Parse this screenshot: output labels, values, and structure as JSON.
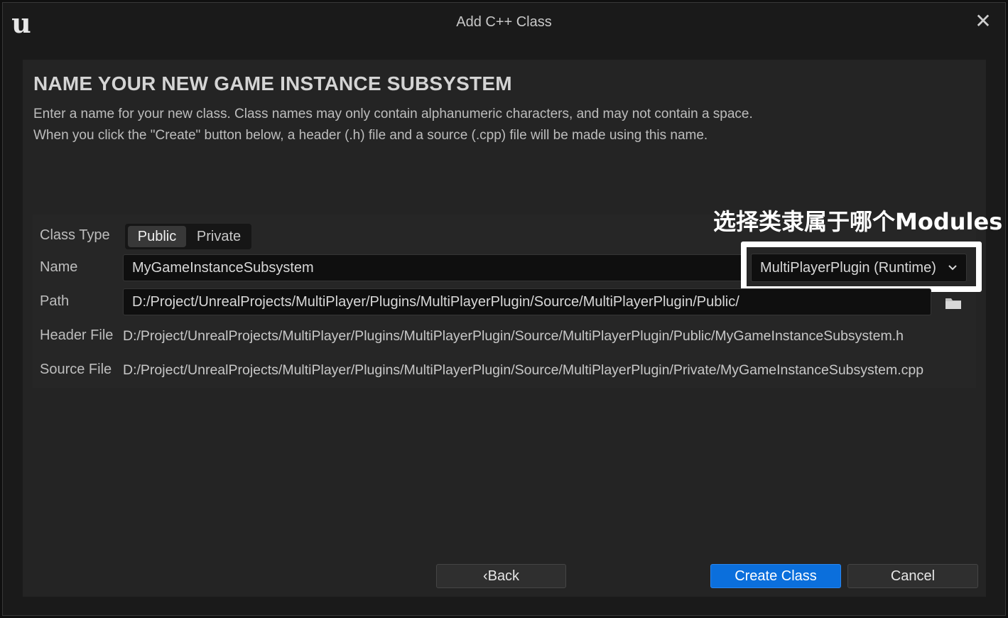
{
  "window": {
    "title": "Add C++ Class",
    "logo_glyph": "u",
    "close_glyph": "✕"
  },
  "page": {
    "heading": "NAME YOUR NEW GAME INSTANCE SUBSYSTEM",
    "description_line1": "Enter a name for your new class. Class names may only contain alphanumeric characters, and may not contain a space.",
    "description_line2": "When you click the \"Create\" button below, a header (.h) file and a source (.cpp) file will be made using this name."
  },
  "form": {
    "class_type_label": "Class Type",
    "class_type_options": [
      "Public",
      "Private"
    ],
    "class_type_selected": "Public",
    "name_label": "Name",
    "name_value": "MyGameInstanceSubsystem",
    "module_selected": "MultiPlayerPlugin (Runtime)",
    "path_label": "Path",
    "path_value": "D:/Project/UnrealProjects/MultiPlayer/Plugins/MultiPlayerPlugin/Source/MultiPlayerPlugin/Public/",
    "header_file_label": "Header File",
    "header_file_value": "D:/Project/UnrealProjects/MultiPlayer/Plugins/MultiPlayerPlugin/Source/MultiPlayerPlugin/Public/MyGameInstanceSubsystem.h",
    "source_file_label": "Source File",
    "source_file_value": "D:/Project/UnrealProjects/MultiPlayer/Plugins/MultiPlayerPlugin/Source/MultiPlayerPlugin/Private/MyGameInstanceSubsystem.cpp"
  },
  "annotation": {
    "text": "选择类隶属于哪个Modules"
  },
  "buttons": {
    "back": "‹Back",
    "create": "Create Class",
    "cancel": "Cancel"
  },
  "colors": {
    "accent": "#0b6fdc",
    "background": "#242424",
    "highlight": "#ffffff"
  },
  "icons": {
    "folder": "folder-icon",
    "chevron": "chevron-down-icon",
    "close": "close-icon"
  }
}
